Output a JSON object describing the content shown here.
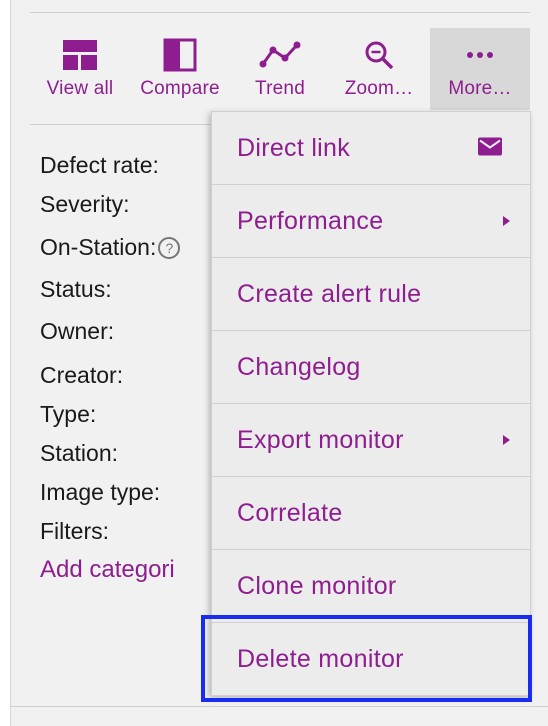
{
  "toolbar": {
    "items": [
      {
        "label": "View all",
        "icon": "view-all-icon"
      },
      {
        "label": "Compare",
        "icon": "compare-icon"
      },
      {
        "label": "Trend",
        "icon": "trend-icon"
      },
      {
        "label": "Zoom…",
        "icon": "zoom-icon"
      },
      {
        "label": "More…",
        "icon": "more-icon"
      }
    ]
  },
  "properties": {
    "labels": [
      "Defect rate:",
      "Severity:",
      "On-Station:",
      "Status:",
      "Owner:",
      "Creator:",
      "Type:",
      "Station:",
      "Image type:",
      "Filters:"
    ],
    "help_glyph": "?",
    "add_category": "Add categori"
  },
  "menu": {
    "items": [
      {
        "label": "Direct link",
        "right": "envelope-icon"
      },
      {
        "label": "Performance",
        "right": "submenu-arrow-icon"
      },
      {
        "label": "Create alert rule"
      },
      {
        "label": "Changelog"
      },
      {
        "label": "Export monitor",
        "right": "submenu-arrow-icon"
      },
      {
        "label": "Correlate"
      },
      {
        "label": "Clone monitor"
      },
      {
        "label": "Delete monitor"
      }
    ]
  },
  "colors": {
    "accent": "#8e1e8f",
    "highlight": "#1a2cf0",
    "background": "#f1f1f1",
    "menu_background": "#ececec"
  }
}
